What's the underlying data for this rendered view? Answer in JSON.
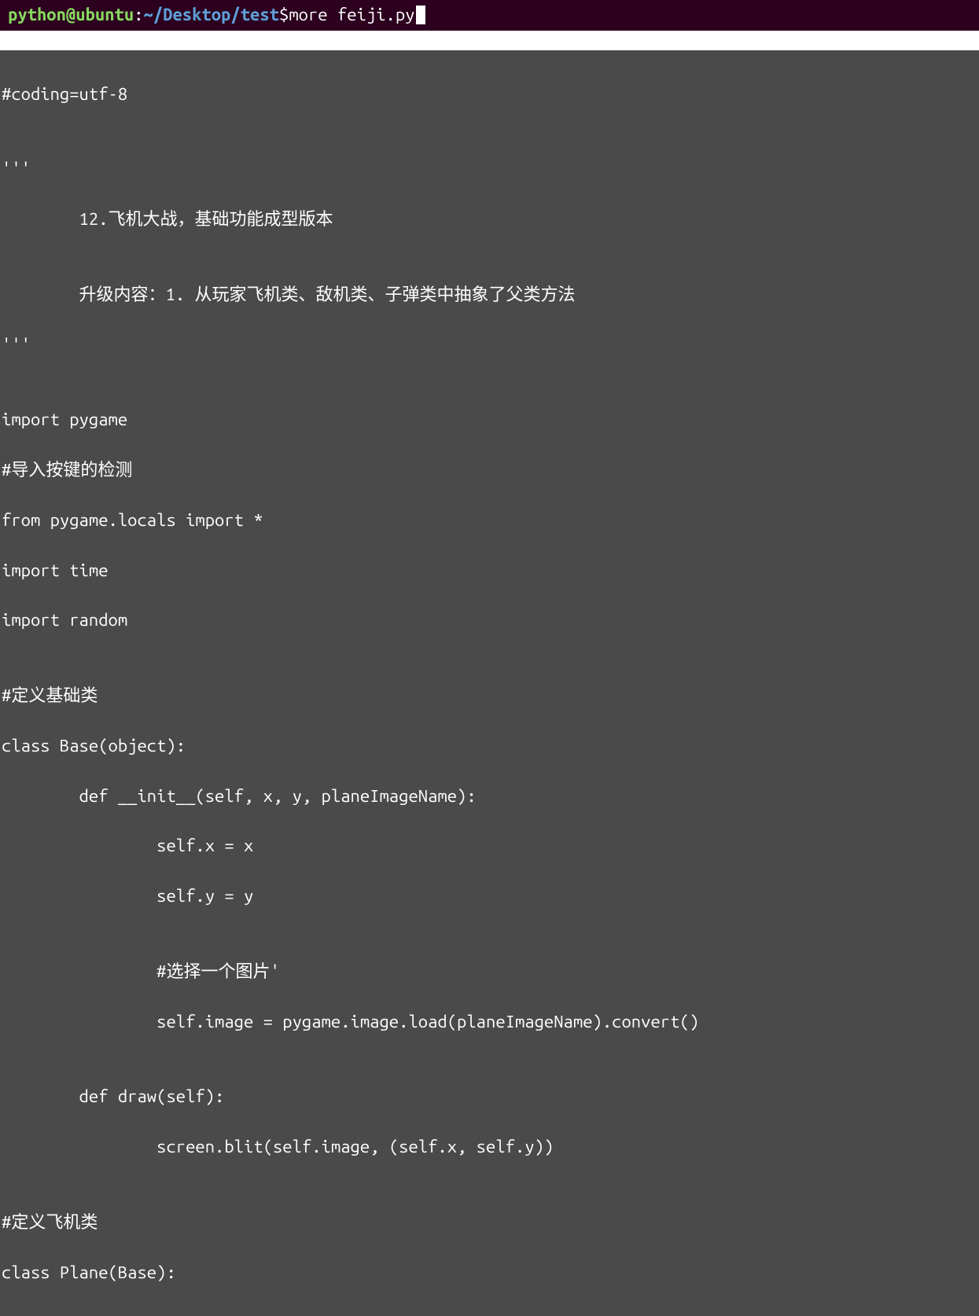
{
  "prompt": {
    "user_host": "python@ubuntu",
    "colon": ":",
    "path": "~/Desktop/test",
    "dollar": "$",
    "command": " more feiji.py"
  },
  "code": {
    "l01": "#coding=utf-8",
    "l02": "",
    "l03": "'''",
    "l04": "        12.飞机大战，基础功能成型版本",
    "l05": "",
    "l06": "        升级内容：1. 从玩家飞机类、敌机类、子弹类中抽象了父类方法",
    "l07": "'''",
    "l08": "",
    "l09": "import pygame",
    "l10": "#导入按键的检测",
    "l11": "from pygame.locals import *",
    "l12": "import time",
    "l13": "import random",
    "l14": "",
    "l15": "#定义基础类",
    "l16": "class Base(object):",
    "l17": "        def __init__(self, x, y, planeImageName):",
    "l18": "                self.x = x",
    "l19": "                self.y = y",
    "l20": "",
    "l21": "                #选择一个图片'",
    "l22": "                self.image = pygame.image.load(planeImageName).convert()",
    "l23": "",
    "l24": "        def draw(self):",
    "l25": "                screen.blit(self.image, (self.x, self.y))",
    "l26": "",
    "l27": "#定义飞机类",
    "l28": "class Plane(Base):"
  }
}
